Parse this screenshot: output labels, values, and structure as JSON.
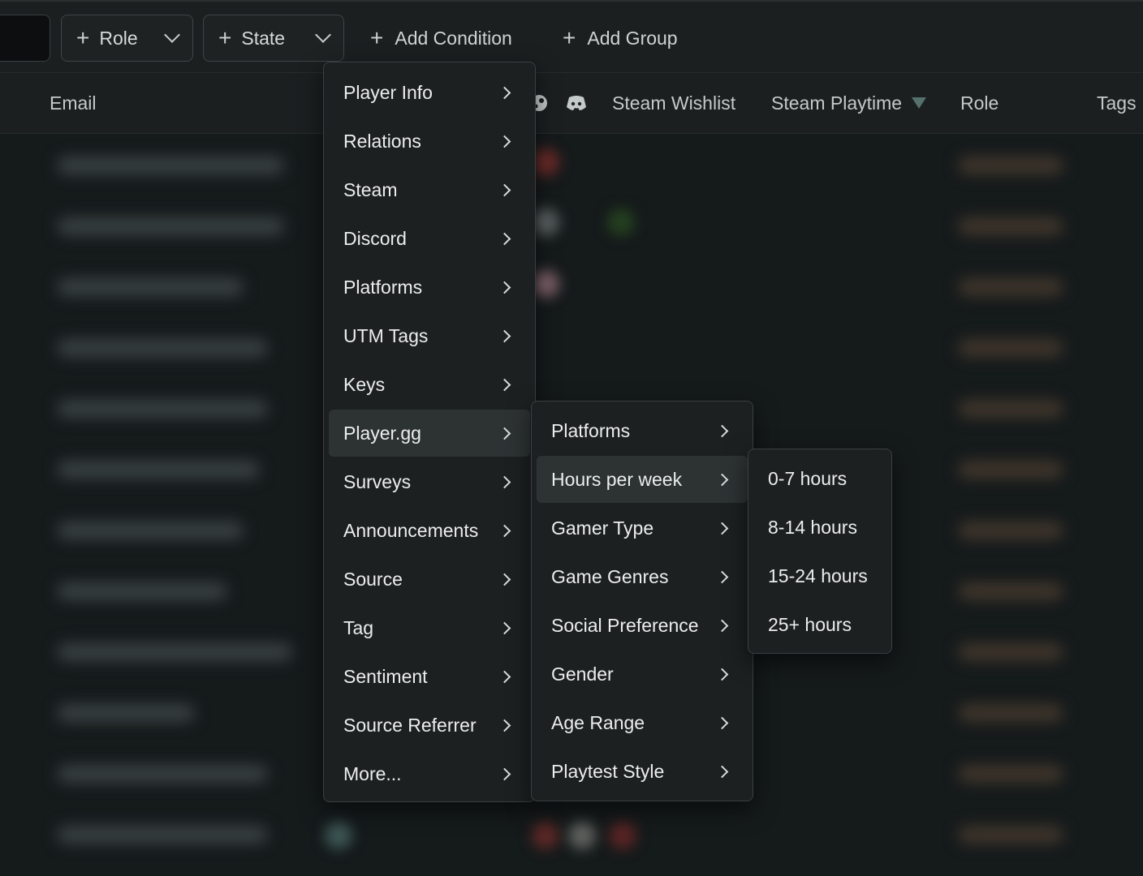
{
  "toolbar": {
    "role_label": "Role",
    "state_label": "State",
    "add_condition_label": "Add Condition",
    "add_group_label": "Add Group"
  },
  "table": {
    "columns": {
      "email": "Email",
      "steam_wishlist": "Steam Wishlist",
      "steam_playtime": "Steam Playtime",
      "role": "Role",
      "tags": "Tags"
    }
  },
  "menu_level1": {
    "items": [
      "Player Info",
      "Relations",
      "Steam",
      "Discord",
      "Platforms",
      "UTM Tags",
      "Keys",
      "Player.gg",
      "Surveys",
      "Announcements",
      "Source",
      "Tag",
      "Sentiment",
      "Source Referrer",
      "More..."
    ],
    "active": "Player.gg"
  },
  "menu_level2": {
    "items": [
      "Platforms",
      "Hours per week",
      "Gamer Type",
      "Game Genres",
      "Social Preference",
      "Gender",
      "Age Range",
      "Playtest Style"
    ],
    "active": "Hours per week"
  },
  "menu_level3": {
    "items": [
      "0-7 hours",
      "8-14 hours",
      "15-24 hours",
      "25+ hours"
    ]
  }
}
